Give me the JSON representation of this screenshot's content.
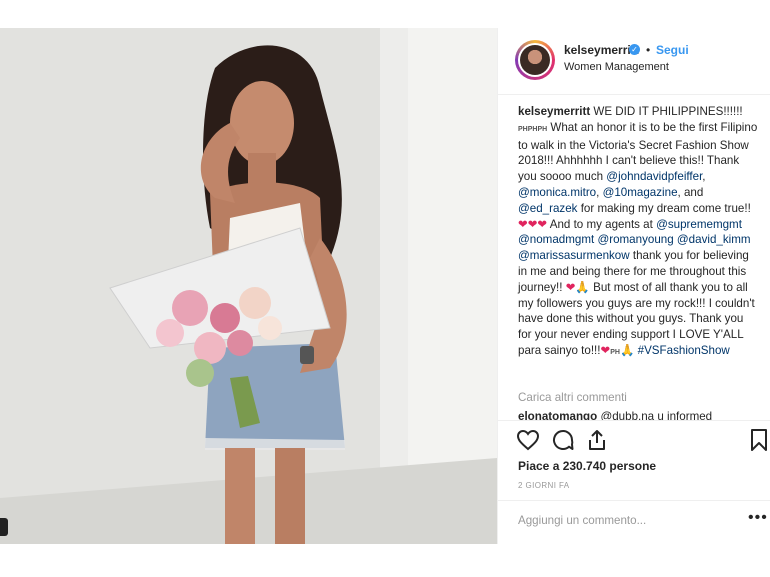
{
  "post": {
    "username": "kelseymerritt",
    "verified_icon": "verified-badge-icon",
    "separator": "•",
    "follow_label": "Segui",
    "location": "Women Management",
    "caption": {
      "user": "kelseymerritt",
      "t1": " WE DID IT PHILIPPINES!!!!!! ",
      "flags": "PHPHPH",
      "t2": " What an honor it is to be the first Filipino to walk in the Victoria's Secret Fashion Show 2018!!! Ahhhhhh I can't believe this!! Thank you soooo much ",
      "m1": "@johndavidpfeiffer",
      "t3": ", ",
      "m2": "@monica.mitro",
      "t4": ", ",
      "m3": "@10magazine",
      "t5": ", and ",
      "m4": "@ed_razek",
      "t6": " for making my dream come true!! ",
      "hearts": "❤❤❤",
      "t7": " And to my agents at ",
      "m5": "@suprememgmt",
      "t8": " ",
      "m6": "@nomadmgmt",
      "t9": " ",
      "m7": "@romanyoung",
      "t10": " ",
      "m8": "@david_kimm",
      "t11": " ",
      "m9": "@marissasurmenkow",
      "t12": " thank you for believing in me and being there for me throughout this journey!! ",
      "heart2": "❤",
      "pray1": "🙏",
      "t13": " But most of all thank you to all my followers you guys are my rock!!! I couldn't have done this without you guys. Thank you for your never ending support I LOVE Y'ALL para sainyo to!!!",
      "heart3": "❤",
      "flag2": "PH",
      "pray2": "🙏",
      "t14": " ",
      "hashtag": "#VSFashionShow"
    },
    "load_more": "Carica altri commenti",
    "partial_comment": {
      "user": "elonatomango",
      "text": " @dubb.na u informed"
    },
    "actions": [
      "heart-icon",
      "comment-icon",
      "share-icon",
      "bookmark-icon"
    ],
    "likes": "Piace a 230.740 persone",
    "time": "2 GIORNI FA",
    "add_comment_placeholder": "Aggiungi un commento...",
    "more_options": "•••"
  }
}
